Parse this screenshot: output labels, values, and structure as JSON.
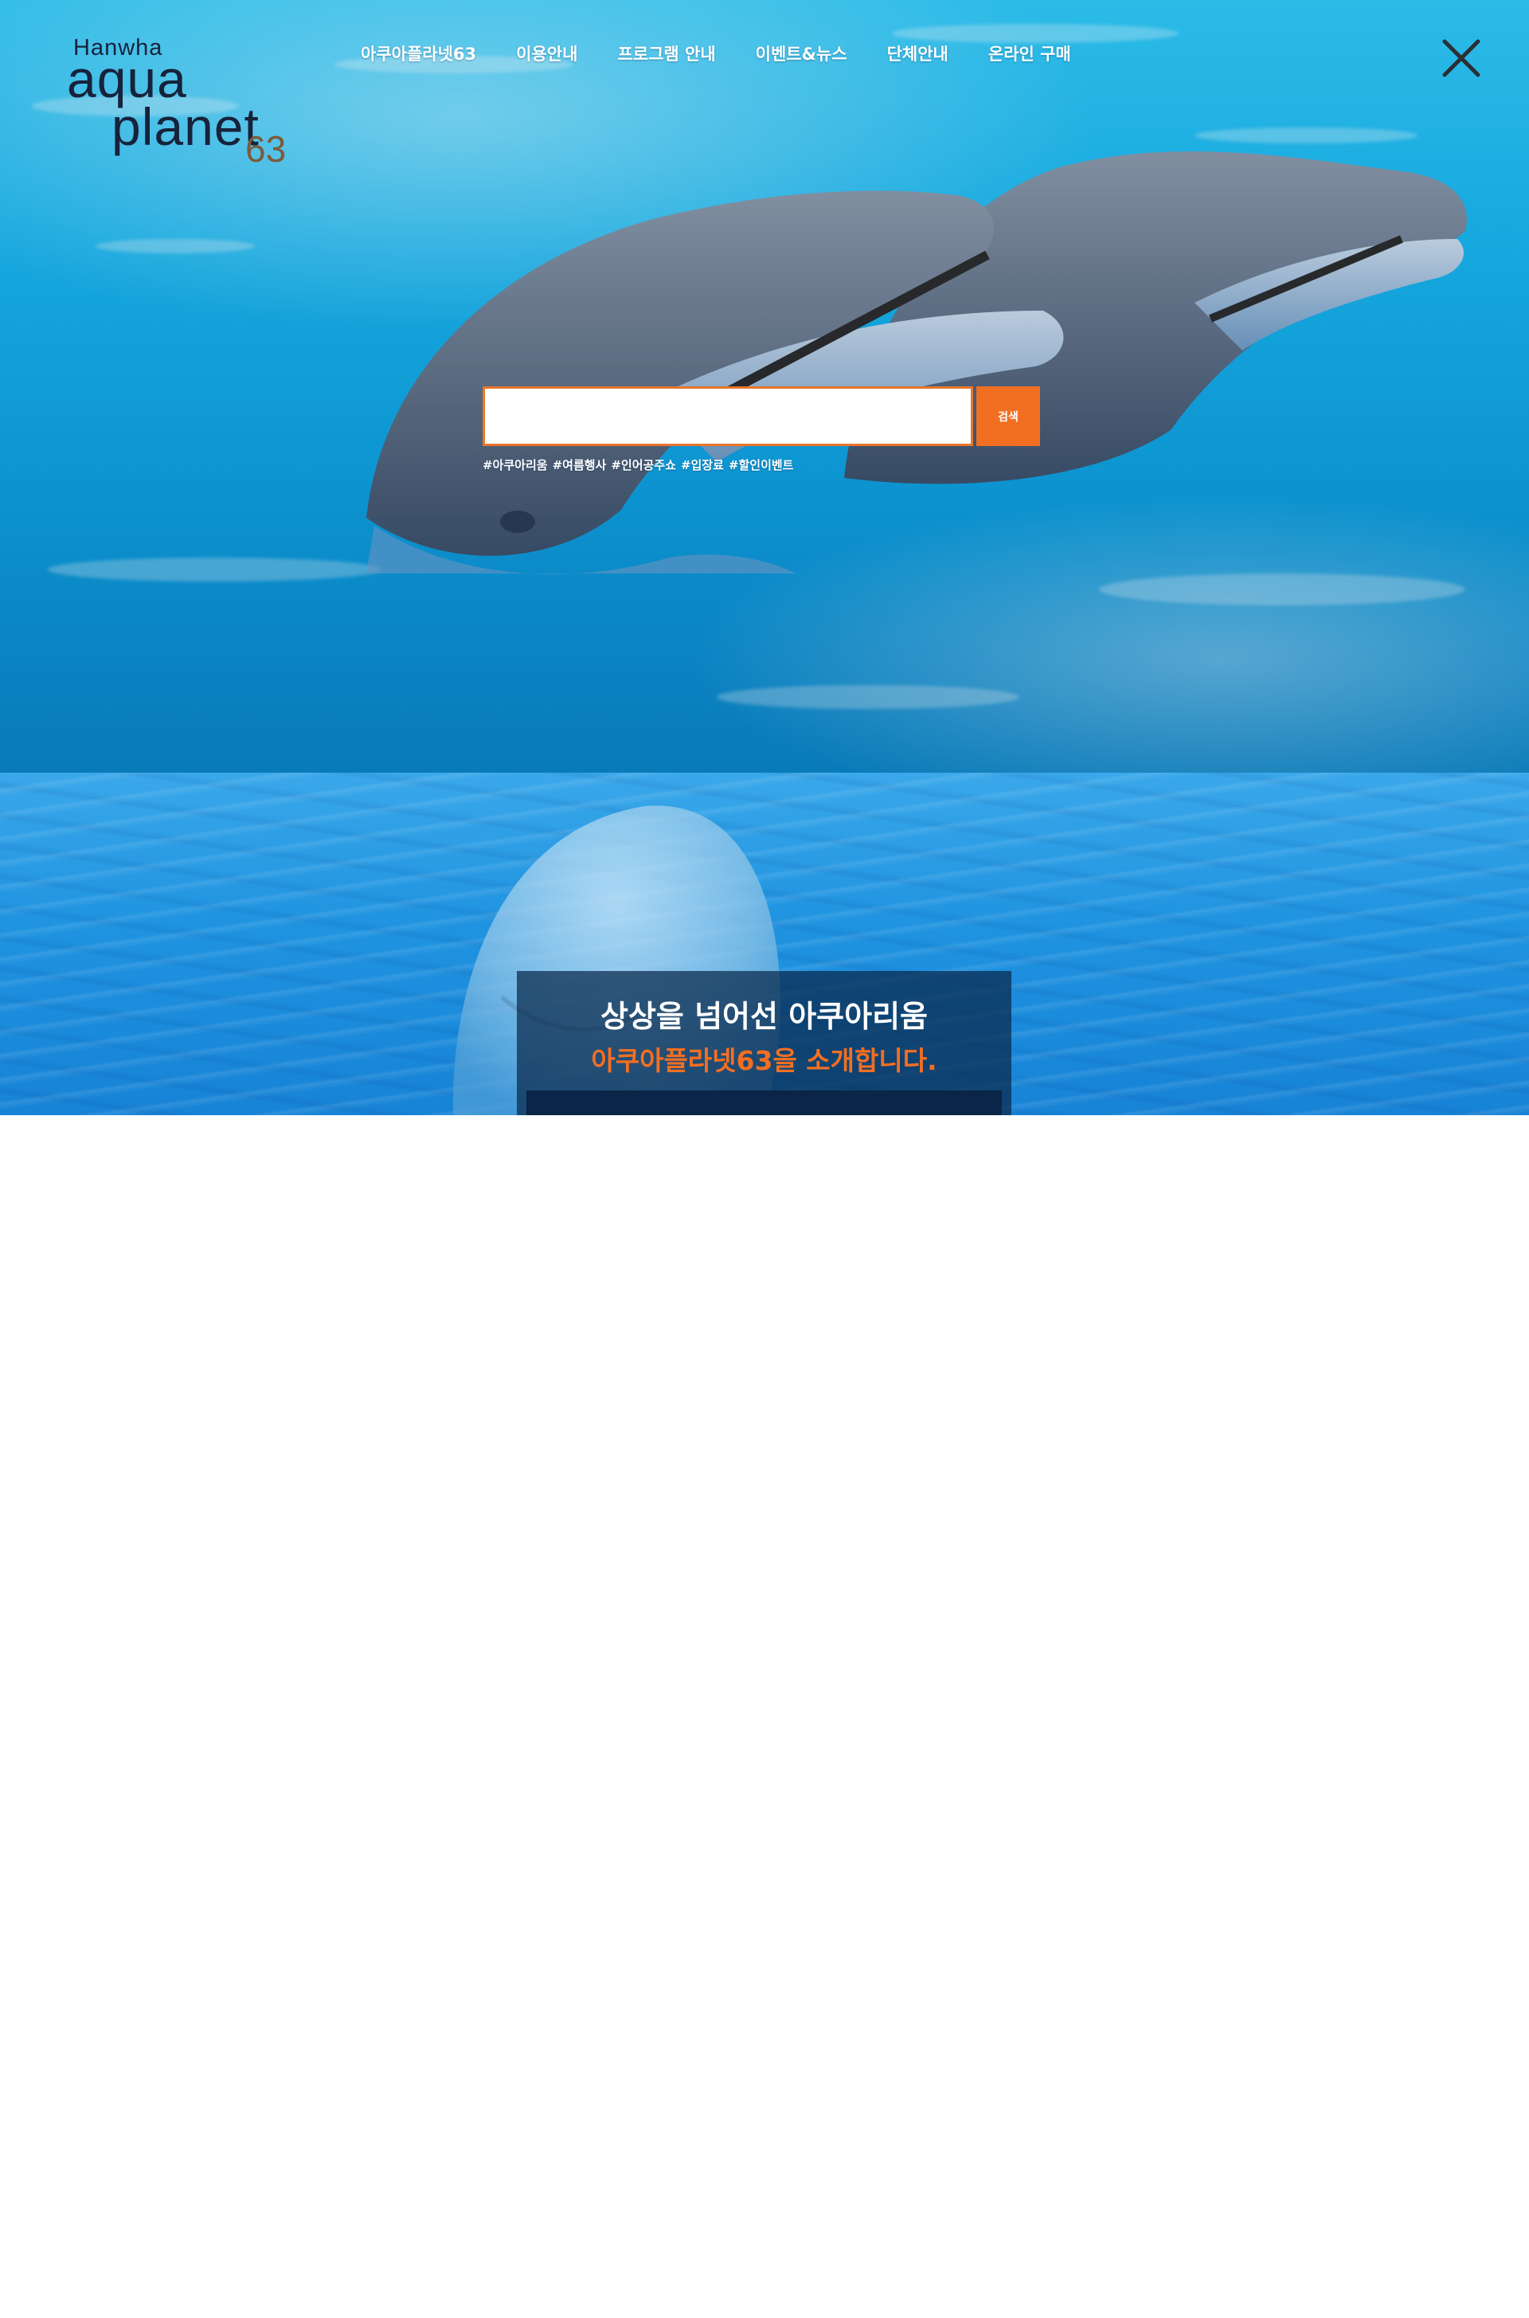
{
  "header": {
    "logo": {
      "brand": "Hanwha",
      "line1": "aqua",
      "line2": "planet",
      "number": "63"
    },
    "nav": [
      {
        "label": "아쿠아플라넷63"
      },
      {
        "label": "이용안내"
      },
      {
        "label": "프로그램 안내"
      },
      {
        "label": "이벤트&뉴스"
      },
      {
        "label": "단체안내"
      },
      {
        "label": "온라인 구매"
      }
    ],
    "close_icon": "close-icon"
  },
  "search": {
    "input_value": "",
    "placeholder": "",
    "button_label": "검색",
    "tags": [
      "#아쿠아리움",
      "#여름행사",
      "#인어공주쇼",
      "#입장료",
      "#할인이벤트"
    ]
  },
  "intro": {
    "title": "상상을 넘어선 아쿠아리움",
    "subtitle": "아쿠아플라넷63을 소개합니다."
  },
  "colors": {
    "accent": "#f26f21",
    "logo_text": "#17223b",
    "logo_number": "#7d5a3a",
    "intro_box": "#0a2547",
    "water": "#19b4ec"
  }
}
